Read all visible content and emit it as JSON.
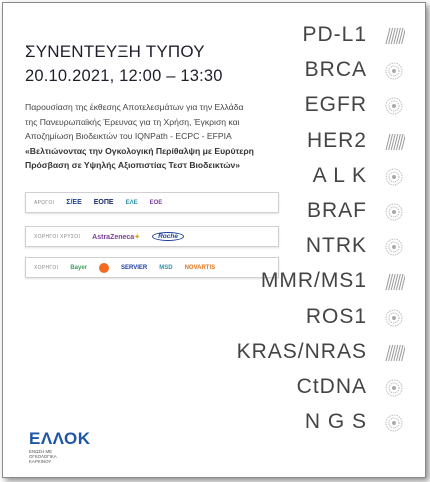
{
  "press": {
    "title": "ΣΥΝΕΝΤΕΥΞΗ ΤΥΠΟΥ",
    "datetime": "20.10.2021, 12:00 – 13:30",
    "desc_line1": "Παρουσίαση της έκθεσης Αποτελεσμάτων για την Ελλάδα",
    "desc_line2": "της Πανευρωπαϊκής Έρευνας για τη Χρήση, Έγκριση και",
    "desc_line3": "Αποζημίωση Βιοδεικτών του IQNPath - ECPC - EFPIA",
    "desc_bold1": "«Βελτιώνοντας την Ογκολογική Περίθαλψη με Ευρύτερη",
    "desc_bold2": "Πρόσβαση σε Υψηλής Αξιοπιστίας Τεστ Βιοδεικτών»"
  },
  "logos": {
    "row1": {
      "label": "ΑΡΩΓΟΙ",
      "items": [
        "Σ/ΕΕ",
        "ΕΟΠΕ",
        "ΕΛΕ",
        "ΕΟΕ"
      ]
    },
    "row2": {
      "label": "ΧΟΡΗΓΟΙ ΧΡΥΣΟΙ",
      "items": [
        "AstraZeneca",
        "Roche"
      ]
    },
    "row3": {
      "label": "ΧΟΡΗΓΟΙ",
      "items": [
        "Bayer",
        "GSK",
        "SERVIER",
        "MSD",
        "NOVARTIS"
      ]
    }
  },
  "org": {
    "name": "ΕΛΛΟΚ",
    "sub1": "ΕΝΩΣΗ ΜΕ",
    "sub2": "ΟΓΚΟΛΟΓΙΚΑ",
    "sub3": "ΚΑΡΚΙΝΟΥ"
  },
  "biomarkers": [
    {
      "label": "PD-L1"
    },
    {
      "label": "BRCA"
    },
    {
      "label": "EGFR"
    },
    {
      "label": "HER2"
    },
    {
      "label": "A L K"
    },
    {
      "label": "BRAF"
    },
    {
      "label": "NTRK"
    },
    {
      "label": "MMR/MS1"
    },
    {
      "label": "ROS1"
    },
    {
      "label": "KRAS/NRAS"
    },
    {
      "label": "CtDNA"
    },
    {
      "label": "N G S"
    }
  ],
  "colors": {
    "title": "#1f1f2b",
    "org_blue": "#1d55a8",
    "biomarker_text": "#444444"
  }
}
